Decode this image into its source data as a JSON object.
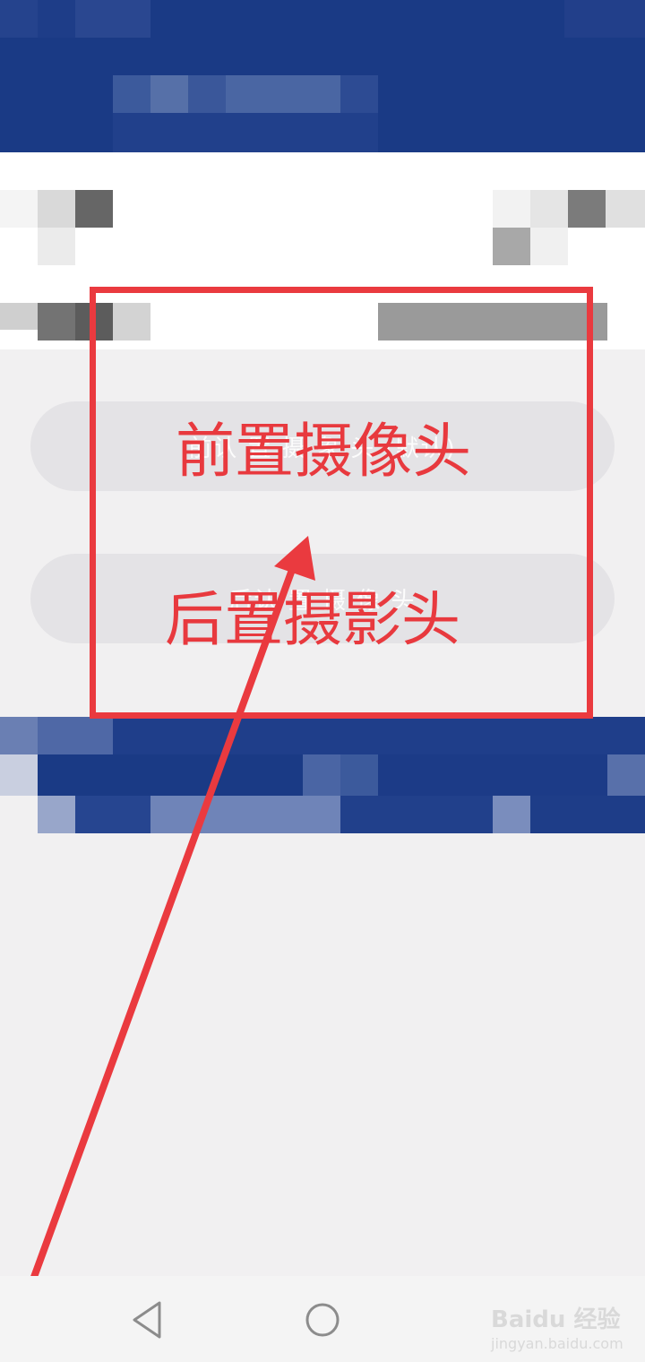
{
  "options": {
    "front_camera": {
      "ghost_label": "前认  置  摄  象  头   (默认)"
    },
    "rear_camera": {
      "ghost_label": "后认  置  摄  像  头"
    }
  },
  "annotation": {
    "front_label": "前置摄像头",
    "rear_label": "后置摄影头",
    "color": "#ea3a3f"
  },
  "nav": {
    "back_icon": "triangle-back-icon",
    "home_icon": "circle-home-icon"
  },
  "watermark": {
    "brand": "Baidu 经验",
    "url": "jingyan.baidu.com"
  },
  "colors": {
    "header_blue": "#1a3a85",
    "background": "#f1f0f1",
    "button_bg": "#e4e3e6"
  }
}
